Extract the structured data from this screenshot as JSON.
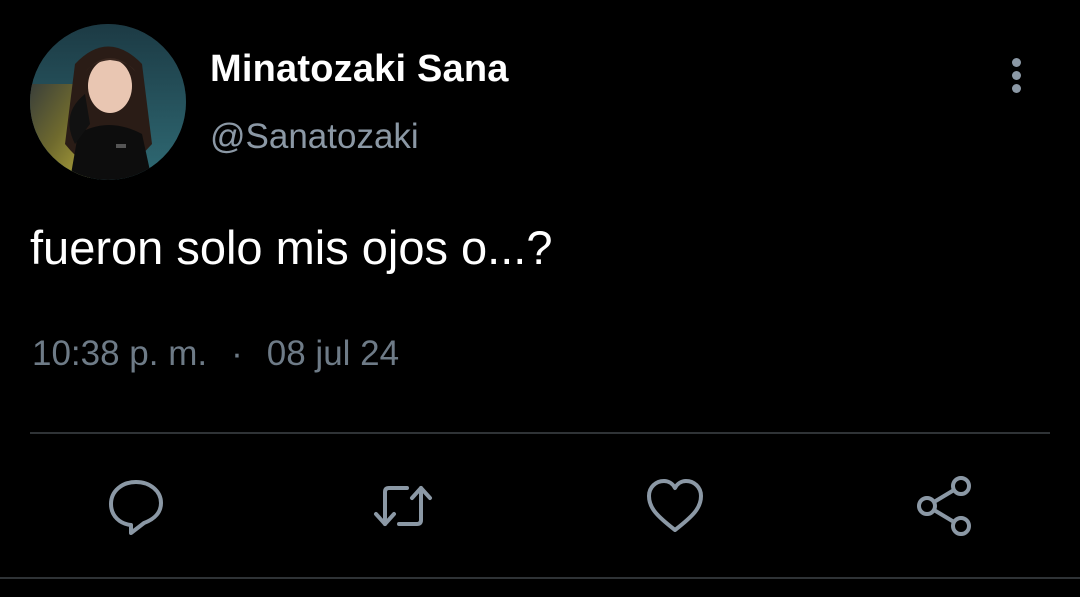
{
  "tweet": {
    "author": {
      "display_name": "Minatozaki Sana",
      "handle": "@Sanatozaki"
    },
    "text": "fueron solo mis ojos o...?",
    "time": "10:38 p. m.",
    "separator": "·",
    "date": "08 jul 24"
  },
  "actions": [
    {
      "icon": "reply-icon"
    },
    {
      "icon": "retweet-icon"
    },
    {
      "icon": "like-icon"
    },
    {
      "icon": "share-icon"
    }
  ],
  "colors": {
    "background": "#000000",
    "primary_text": "#ffffff",
    "secondary_text": "#8b98a5",
    "divider": "#2f3336"
  }
}
